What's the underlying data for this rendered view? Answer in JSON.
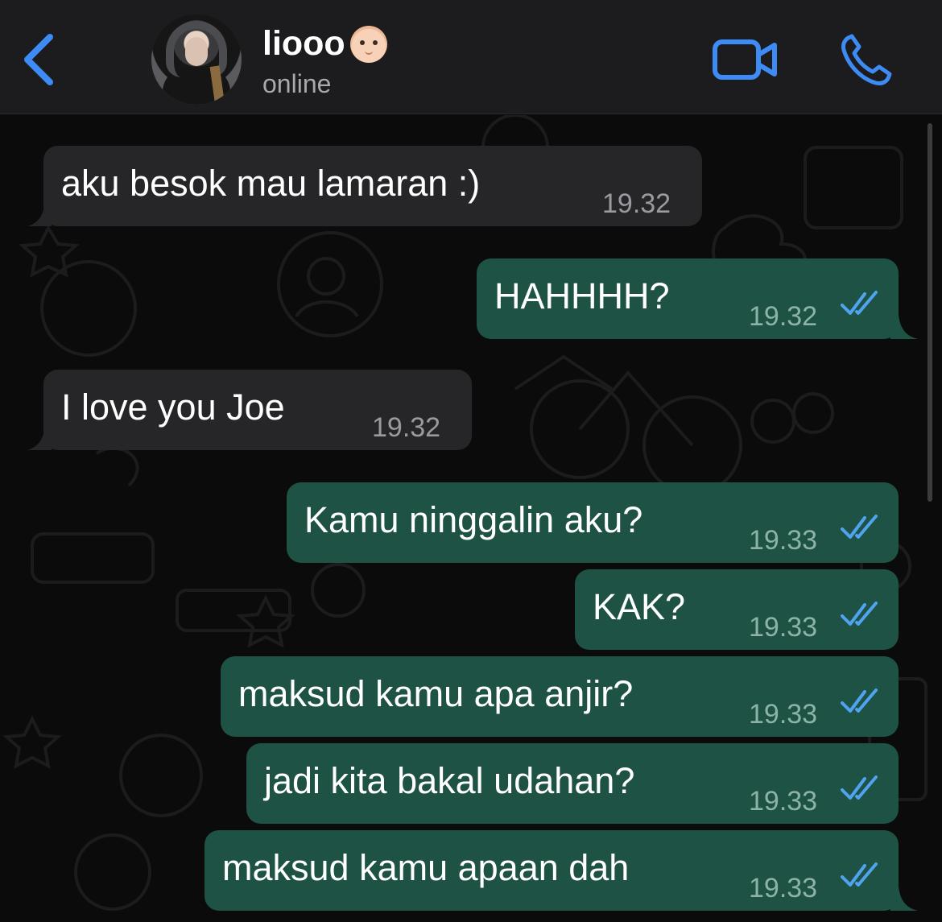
{
  "header": {
    "contact_name": "liooo",
    "contact_emoji": "baby-emoji",
    "status": "online",
    "accent_color": "#3d8bf5"
  },
  "messages": [
    {
      "direction": "in",
      "text": "aku besok mau lamaran :)",
      "time": "19.32"
    },
    {
      "direction": "out",
      "text": "HAHHHH?",
      "time": "19.32",
      "read": true
    },
    {
      "direction": "in",
      "text": "I love you Joe",
      "time": "19.32"
    },
    {
      "direction": "out",
      "text": "Kamu ninggalin aku?",
      "time": "19.33",
      "read": true
    },
    {
      "direction": "out",
      "text": "KAK?",
      "time": "19.33",
      "read": true
    },
    {
      "direction": "out",
      "text": "maksud kamu apa anjir?",
      "time": "19.33",
      "read": true
    },
    {
      "direction": "out",
      "text": "jadi kita bakal udahan?",
      "time": "19.33",
      "read": true
    },
    {
      "direction": "out",
      "text": "maksud kamu apaan dah",
      "time": "19.33",
      "read": true
    }
  ],
  "colors": {
    "incoming_bubble": "#262628",
    "outgoing_bubble": "#1d5244",
    "read_ticks": "#4fa3ef"
  }
}
